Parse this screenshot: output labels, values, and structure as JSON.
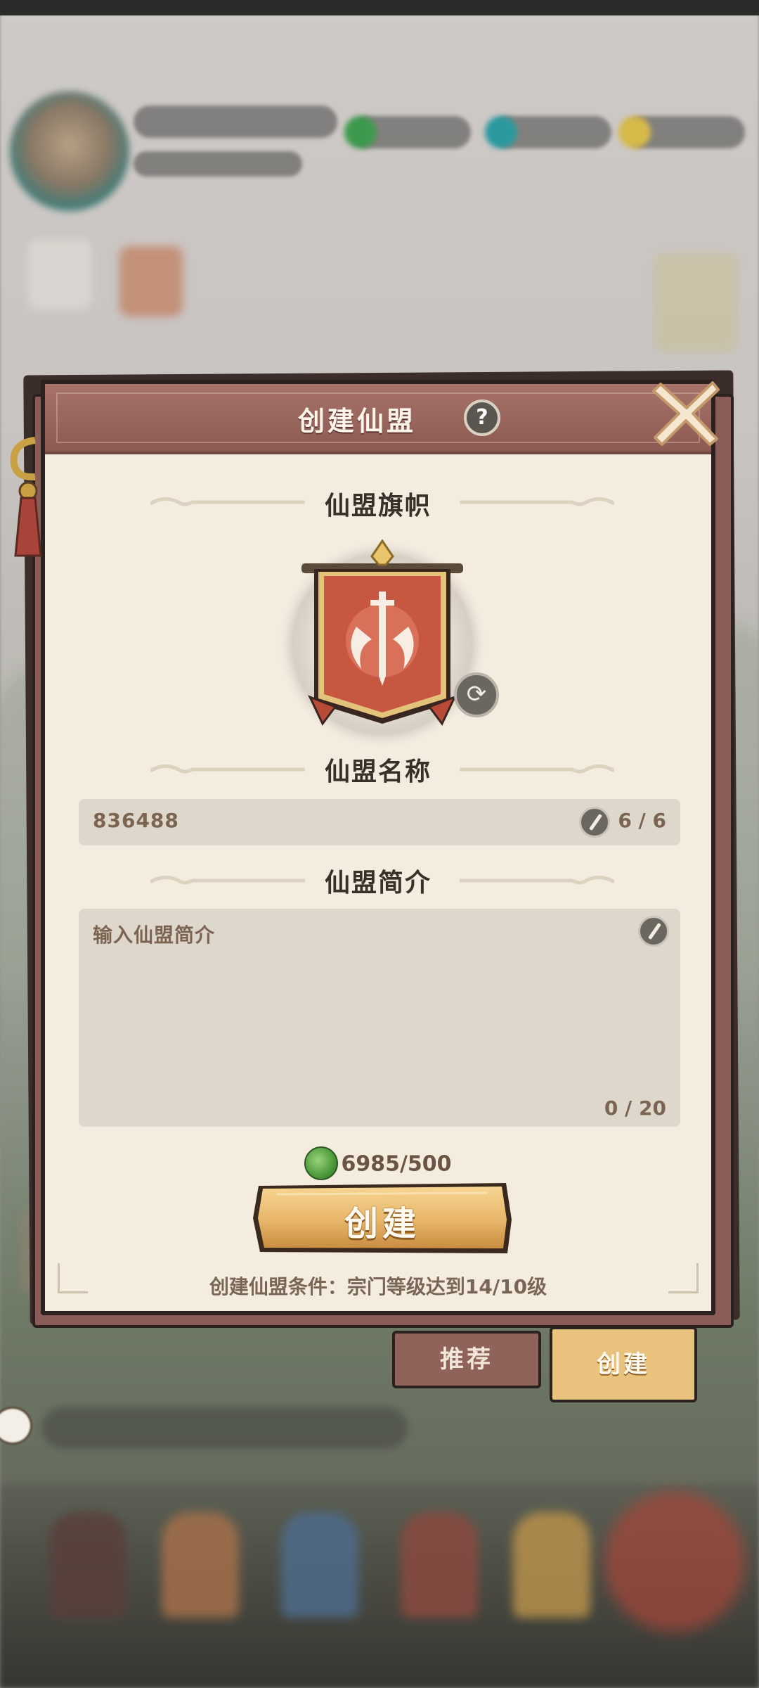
{
  "dialog": {
    "title": "创建仙盟",
    "help_icon": "?",
    "close_icon": "close-x-icon",
    "banner_section_label": "仙盟旗帜",
    "banner_icon": "sword-banner-icon",
    "refresh_icon": "refresh-icon",
    "name_section_label": "仙盟名称",
    "name_value": "836488",
    "name_count": "6 / 6",
    "intro_section_label": "仙盟简介",
    "intro_placeholder": "输入仙盟简介",
    "intro_count": "0 / 20",
    "cost_icon": "jade-currency-icon",
    "cost_text": "6985/500",
    "create_label": "创建",
    "condition_text": "创建仙盟条件：宗门等级达到14/10级"
  },
  "tabs": [
    {
      "label": "推荐",
      "active": false
    },
    {
      "label": "创建",
      "active": true
    }
  ],
  "colors": {
    "header": "#8c5a52",
    "paper": "#f3ecdf",
    "button_gold": "#e7b66a",
    "text_brown": "#7b6452"
  }
}
